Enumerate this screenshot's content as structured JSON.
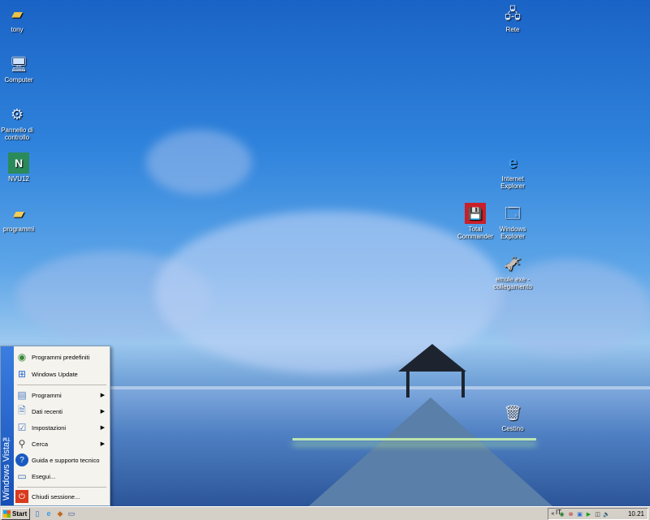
{
  "desktop_icons": {
    "tony": "tony",
    "computer": "Computer",
    "control_panel": "Pannello di controllo",
    "nvu": "NVU12",
    "programmi": "programmi",
    "rete": "Rete",
    "internet_explorer": "Internet Explorer",
    "total_commander": "Total Commander",
    "windows_explorer": "Windows Explorer",
    "emule": "emule.exe - collegamento",
    "cestino": "Cestino"
  },
  "start_menu": {
    "banner": "Windows Vista™",
    "items": {
      "default_programs": "Programmi predefiniti",
      "windows_update": "Windows Update",
      "programs": "Programmi",
      "recent": "Dati recenti",
      "settings": "Impostazioni",
      "search": "Cerca",
      "help": "Guida e supporto tecnico",
      "run": "Esegui...",
      "shutdown": "Chiudi sessione..."
    }
  },
  "taskbar": {
    "start_label": "Start",
    "language": "IT",
    "clock": "10.21"
  },
  "icons": {
    "folder": "folder-icon",
    "computer": "computer-icon",
    "control_panel": "control-panel-icon",
    "network": "network-icon",
    "ie": "internet-explorer-icon",
    "recycle": "recycle-bin-icon"
  }
}
